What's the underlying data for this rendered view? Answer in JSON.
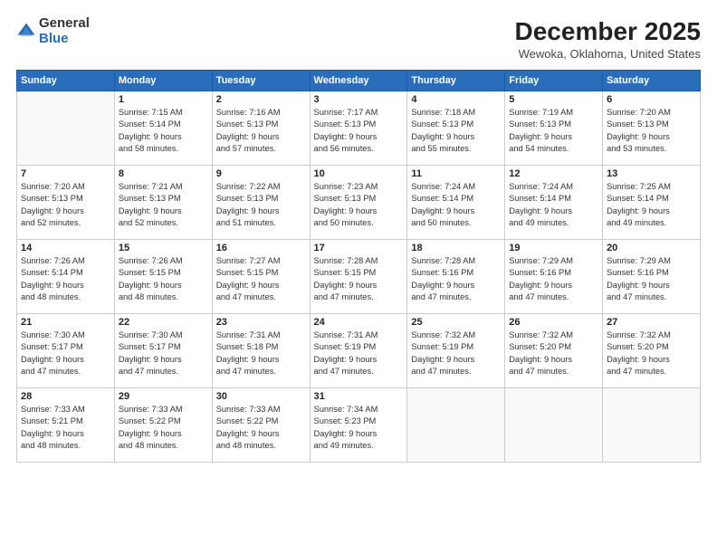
{
  "logo": {
    "general": "General",
    "blue": "Blue"
  },
  "title": "December 2025",
  "subtitle": "Wewoka, Oklahoma, United States",
  "headers": [
    "Sunday",
    "Monday",
    "Tuesday",
    "Wednesday",
    "Thursday",
    "Friday",
    "Saturday"
  ],
  "weeks": [
    [
      {
        "day": "",
        "info": ""
      },
      {
        "day": "1",
        "info": "Sunrise: 7:15 AM\nSunset: 5:14 PM\nDaylight: 9 hours\nand 58 minutes."
      },
      {
        "day": "2",
        "info": "Sunrise: 7:16 AM\nSunset: 5:13 PM\nDaylight: 9 hours\nand 57 minutes."
      },
      {
        "day": "3",
        "info": "Sunrise: 7:17 AM\nSunset: 5:13 PM\nDaylight: 9 hours\nand 56 minutes."
      },
      {
        "day": "4",
        "info": "Sunrise: 7:18 AM\nSunset: 5:13 PM\nDaylight: 9 hours\nand 55 minutes."
      },
      {
        "day": "5",
        "info": "Sunrise: 7:19 AM\nSunset: 5:13 PM\nDaylight: 9 hours\nand 54 minutes."
      },
      {
        "day": "6",
        "info": "Sunrise: 7:20 AM\nSunset: 5:13 PM\nDaylight: 9 hours\nand 53 minutes."
      }
    ],
    [
      {
        "day": "7",
        "info": "Sunrise: 7:20 AM\nSunset: 5:13 PM\nDaylight: 9 hours\nand 52 minutes."
      },
      {
        "day": "8",
        "info": "Sunrise: 7:21 AM\nSunset: 5:13 PM\nDaylight: 9 hours\nand 52 minutes."
      },
      {
        "day": "9",
        "info": "Sunrise: 7:22 AM\nSunset: 5:13 PM\nDaylight: 9 hours\nand 51 minutes."
      },
      {
        "day": "10",
        "info": "Sunrise: 7:23 AM\nSunset: 5:13 PM\nDaylight: 9 hours\nand 50 minutes."
      },
      {
        "day": "11",
        "info": "Sunrise: 7:24 AM\nSunset: 5:14 PM\nDaylight: 9 hours\nand 50 minutes."
      },
      {
        "day": "12",
        "info": "Sunrise: 7:24 AM\nSunset: 5:14 PM\nDaylight: 9 hours\nand 49 minutes."
      },
      {
        "day": "13",
        "info": "Sunrise: 7:25 AM\nSunset: 5:14 PM\nDaylight: 9 hours\nand 49 minutes."
      }
    ],
    [
      {
        "day": "14",
        "info": "Sunrise: 7:26 AM\nSunset: 5:14 PM\nDaylight: 9 hours\nand 48 minutes."
      },
      {
        "day": "15",
        "info": "Sunrise: 7:26 AM\nSunset: 5:15 PM\nDaylight: 9 hours\nand 48 minutes."
      },
      {
        "day": "16",
        "info": "Sunrise: 7:27 AM\nSunset: 5:15 PM\nDaylight: 9 hours\nand 47 minutes."
      },
      {
        "day": "17",
        "info": "Sunrise: 7:28 AM\nSunset: 5:15 PM\nDaylight: 9 hours\nand 47 minutes."
      },
      {
        "day": "18",
        "info": "Sunrise: 7:28 AM\nSunset: 5:16 PM\nDaylight: 9 hours\nand 47 minutes."
      },
      {
        "day": "19",
        "info": "Sunrise: 7:29 AM\nSunset: 5:16 PM\nDaylight: 9 hours\nand 47 minutes."
      },
      {
        "day": "20",
        "info": "Sunrise: 7:29 AM\nSunset: 5:16 PM\nDaylight: 9 hours\nand 47 minutes."
      }
    ],
    [
      {
        "day": "21",
        "info": "Sunrise: 7:30 AM\nSunset: 5:17 PM\nDaylight: 9 hours\nand 47 minutes."
      },
      {
        "day": "22",
        "info": "Sunrise: 7:30 AM\nSunset: 5:17 PM\nDaylight: 9 hours\nand 47 minutes."
      },
      {
        "day": "23",
        "info": "Sunrise: 7:31 AM\nSunset: 5:18 PM\nDaylight: 9 hours\nand 47 minutes."
      },
      {
        "day": "24",
        "info": "Sunrise: 7:31 AM\nSunset: 5:19 PM\nDaylight: 9 hours\nand 47 minutes."
      },
      {
        "day": "25",
        "info": "Sunrise: 7:32 AM\nSunset: 5:19 PM\nDaylight: 9 hours\nand 47 minutes."
      },
      {
        "day": "26",
        "info": "Sunrise: 7:32 AM\nSunset: 5:20 PM\nDaylight: 9 hours\nand 47 minutes."
      },
      {
        "day": "27",
        "info": "Sunrise: 7:32 AM\nSunset: 5:20 PM\nDaylight: 9 hours\nand 47 minutes."
      }
    ],
    [
      {
        "day": "28",
        "info": "Sunrise: 7:33 AM\nSunset: 5:21 PM\nDaylight: 9 hours\nand 48 minutes."
      },
      {
        "day": "29",
        "info": "Sunrise: 7:33 AM\nSunset: 5:22 PM\nDaylight: 9 hours\nand 48 minutes."
      },
      {
        "day": "30",
        "info": "Sunrise: 7:33 AM\nSunset: 5:22 PM\nDaylight: 9 hours\nand 48 minutes."
      },
      {
        "day": "31",
        "info": "Sunrise: 7:34 AM\nSunset: 5:23 PM\nDaylight: 9 hours\nand 49 minutes."
      },
      {
        "day": "",
        "info": ""
      },
      {
        "day": "",
        "info": ""
      },
      {
        "day": "",
        "info": ""
      }
    ]
  ]
}
